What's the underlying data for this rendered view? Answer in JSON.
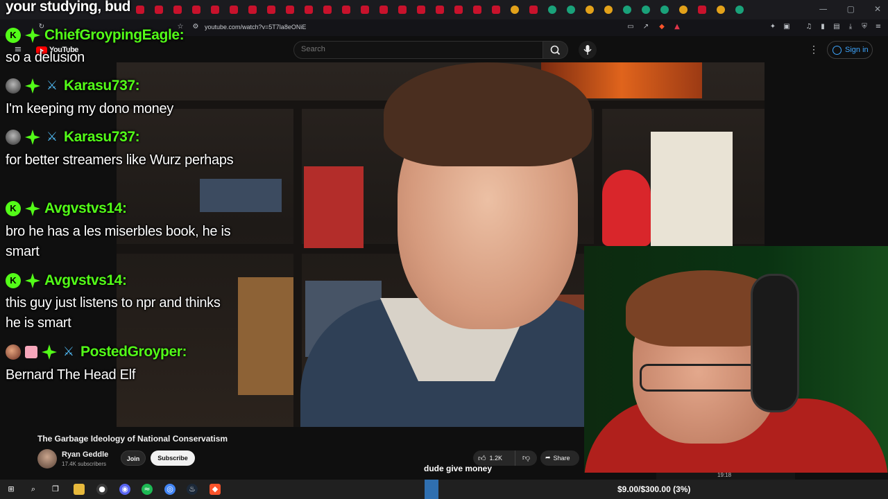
{
  "browser": {
    "url": "youtube.com/watch?v=5T7la8eONiE",
    "win_controls": [
      "—",
      "▢",
      "✕"
    ]
  },
  "youtube": {
    "logo_text": "YouTube",
    "search_placeholder": "Search",
    "sign_in_label": "Sign in"
  },
  "video": {
    "title": "The Garbage Ideology of National Conservatism",
    "channel_name": "Ryan Geddle",
    "subscribers": "17.4K subscribers",
    "join_label": "Join",
    "subscribe_label": "Subscribe",
    "likes": "1.2K",
    "share_label": "Share",
    "mini_time": "19:18"
  },
  "caption_text": "dude give money",
  "chat": {
    "top_text": "your studying, bud",
    "messages": [
      {
        "user": "ChiefGroypingEagle:",
        "text": "so a delusion",
        "badges": [
          "kick-k",
          "diamond"
        ]
      },
      {
        "user": "Karasu737:",
        "text": "I'm keeping my dono money",
        "badges": [
          "avatar",
          "diamond",
          "sword"
        ]
      },
      {
        "user": "Karasu737:",
        "text": "for better streamers like Wurz perhaps",
        "badges": [
          "avatar",
          "diamond",
          "sword"
        ]
      },
      {
        "user": "Avgvstvs14:",
        "text": "bro he has a les miserbles book, he is smart",
        "badges": [
          "kick-k",
          "diamond"
        ]
      },
      {
        "user": "Avgvstvs14:",
        "text": "this guy just listens to npr and thinks he is smart",
        "badges": [
          "kick-k",
          "diamond"
        ]
      },
      {
        "user": "PostedGroyper:",
        "text": "Bernard The Head Elf",
        "badges": [
          "orb",
          "gift",
          "diamond",
          "sword"
        ]
      }
    ]
  },
  "goal_text": "$9.00/$300.00 (3%)",
  "colors": {
    "username": "#53fc18",
    "subscribe_bg": "#f1f1f1",
    "yt_red": "#ff0000",
    "signin_blue": "#3ea6ff"
  }
}
